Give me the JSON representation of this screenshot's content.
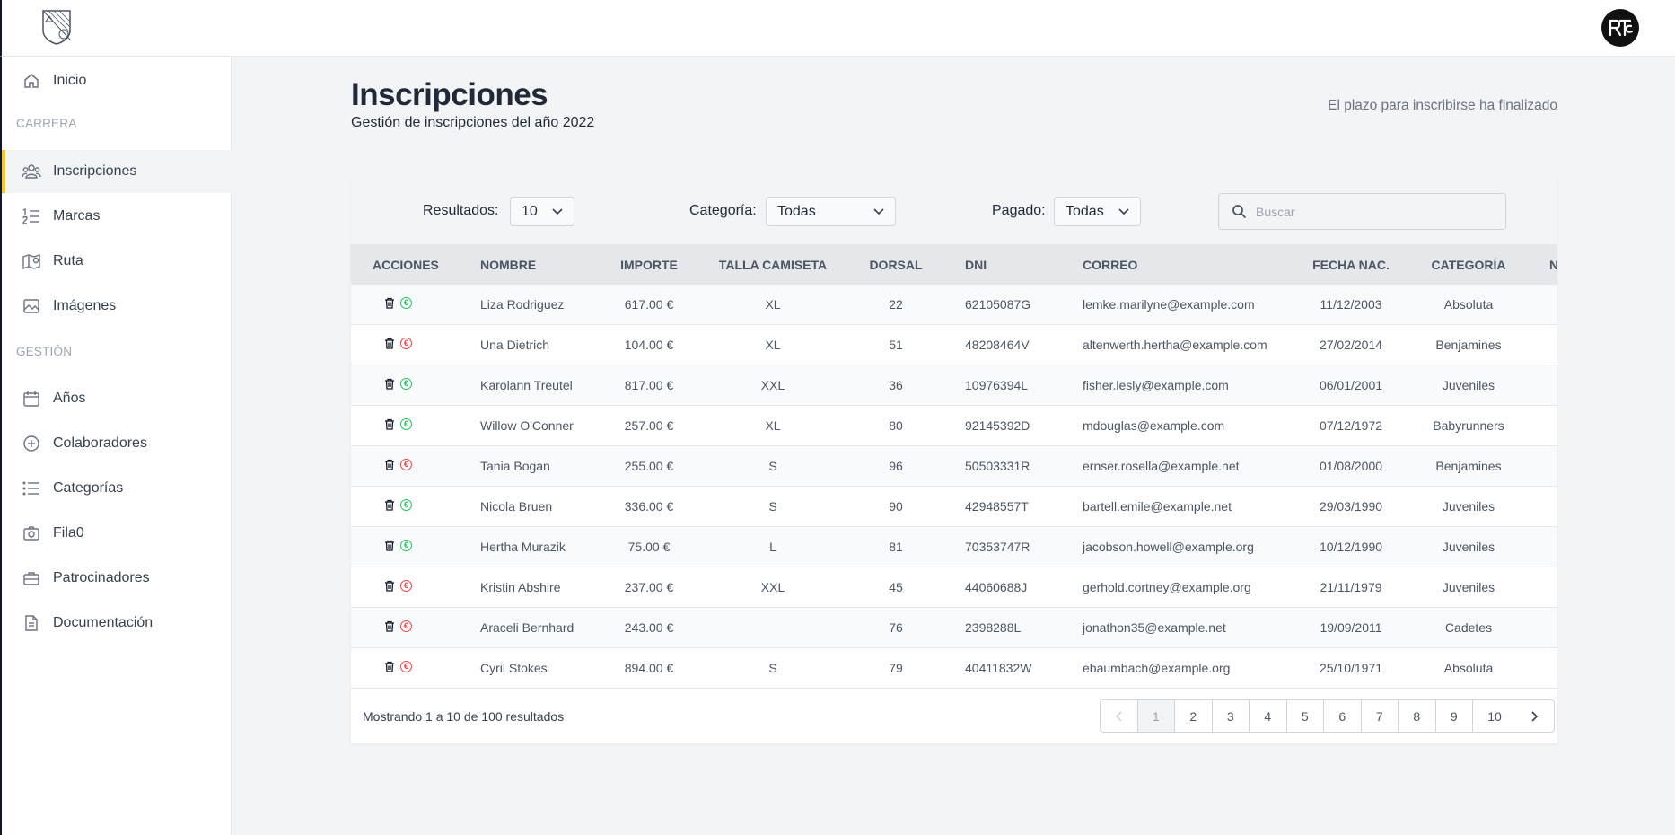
{
  "sidebar": {
    "sections": [
      {
        "label": "CARRERA"
      },
      {
        "label": "GESTIÓN"
      }
    ],
    "items": [
      {
        "label": "Inicio",
        "icon": "home-icon"
      },
      {
        "label": "Inscripciones",
        "icon": "users-icon"
      },
      {
        "label": "Marcas",
        "icon": "ranking-list-icon"
      },
      {
        "label": "Ruta",
        "icon": "map-icon"
      },
      {
        "label": "Imágenes",
        "icon": "image-icon"
      },
      {
        "label": "Años",
        "icon": "calendar-icon"
      },
      {
        "label": "Colaboradores",
        "icon": "plus-circle-icon"
      },
      {
        "label": "Categorías",
        "icon": "list-icon"
      },
      {
        "label": "Fila0",
        "icon": "camera-icon"
      },
      {
        "label": "Patrocinadores",
        "icon": "briefcase-icon"
      },
      {
        "label": "Documentación",
        "icon": "document-icon"
      }
    ]
  },
  "header": {
    "title": "Inscripciones",
    "subtitle": "Gestión de inscripciones del año 2022",
    "deadline": "El plazo para inscribirse ha finalizado"
  },
  "filters": {
    "results_label": "Resultados:",
    "results_value": "10",
    "category_label": "Categoría:",
    "category_value": "Todas",
    "paid_label": "Pagado:",
    "paid_value": "Todas",
    "search_placeholder": "Buscar"
  },
  "table": {
    "columns": [
      "ACCIONES",
      "NOMBRE",
      "IMPORTE",
      "TALLA CAMISETA",
      "DORSAL",
      "DNI",
      "CORREO",
      "FECHA NAC.",
      "CATEGORÍA",
      "N"
    ],
    "rows": [
      {
        "paid": true,
        "name": "Liza Rodriguez",
        "amount": "617.00 €",
        "size": "XL",
        "bib": "22",
        "dni": "62105087G",
        "email": "lemke.marilyne@example.com",
        "birth": "11/12/2003",
        "category": "Absoluta"
      },
      {
        "paid": false,
        "name": "Una Dietrich",
        "amount": "104.00 €",
        "size": "XL",
        "bib": "51",
        "dni": "48208464V",
        "email": "altenwerth.hertha@example.com",
        "birth": "27/02/2014",
        "category": "Benjamines"
      },
      {
        "paid": true,
        "name": "Karolann Treutel",
        "amount": "817.00 €",
        "size": "XXL",
        "bib": "36",
        "dni": "10976394L",
        "email": "fisher.lesly@example.com",
        "birth": "06/01/2001",
        "category": "Juveniles"
      },
      {
        "paid": true,
        "name": "Willow O'Conner",
        "amount": "257.00 €",
        "size": "XL",
        "bib": "80",
        "dni": "92145392D",
        "email": "mdouglas@example.com",
        "birth": "07/12/1972",
        "category": "Babyrunners"
      },
      {
        "paid": false,
        "name": "Tania Bogan",
        "amount": "255.00 €",
        "size": "S",
        "bib": "96",
        "dni": "50503331R",
        "email": "ernser.rosella@example.net",
        "birth": "01/08/2000",
        "category": "Benjamines"
      },
      {
        "paid": true,
        "name": "Nicola Bruen",
        "amount": "336.00 €",
        "size": "S",
        "bib": "90",
        "dni": "42948557T",
        "email": "bartell.emile@example.net",
        "birth": "29/03/1990",
        "category": "Juveniles"
      },
      {
        "paid": true,
        "name": "Hertha Murazik",
        "amount": "75.00 €",
        "size": "L",
        "bib": "81",
        "dni": "70353747R",
        "email": "jacobson.howell@example.org",
        "birth": "10/12/1990",
        "category": "Juveniles"
      },
      {
        "paid": false,
        "name": "Kristin Abshire",
        "amount": "237.00 €",
        "size": "XXL",
        "bib": "45",
        "dni": "44060688J",
        "email": "gerhold.cortney@example.org",
        "birth": "21/11/1979",
        "category": "Juveniles"
      },
      {
        "paid": false,
        "name": "Araceli Bernhard",
        "amount": "243.00 €",
        "size": "",
        "bib": "76",
        "dni": "2398288L",
        "email": "jonathon35@example.net",
        "birth": "19/09/2011",
        "category": "Cadetes"
      },
      {
        "paid": false,
        "name": "Cyril Stokes",
        "amount": "894.00 €",
        "size": "S",
        "bib": "79",
        "dni": "40411832W",
        "email": "ebaumbach@example.org",
        "birth": "25/10/1971",
        "category": "Absoluta"
      }
    ]
  },
  "footer": {
    "summary": "Mostrando 1 a 10 de 100 resultados",
    "pages": [
      "1",
      "2",
      "3",
      "4",
      "5",
      "6",
      "7",
      "8",
      "9",
      "10"
    ],
    "current_page": "1"
  },
  "colors": {
    "accent": "#facc15",
    "paid": "#22c55e",
    "unpaid": "#ef4444"
  }
}
